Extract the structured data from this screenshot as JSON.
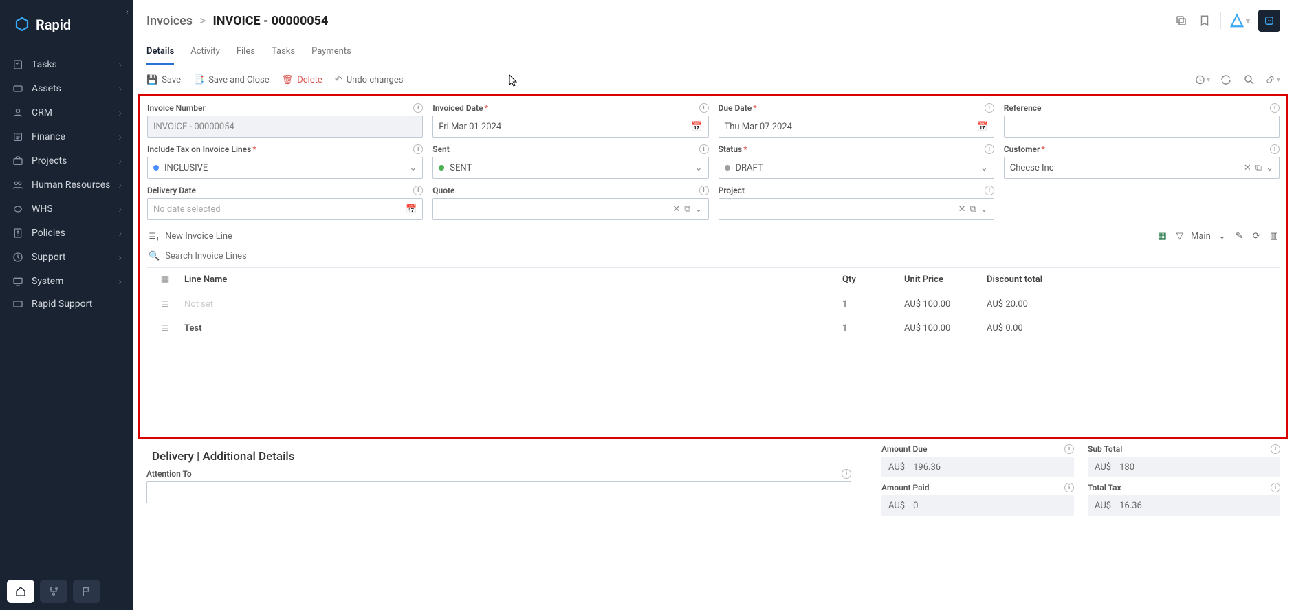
{
  "brand": {
    "name": "Rapid"
  },
  "sidebar": {
    "items": [
      {
        "label": "Tasks"
      },
      {
        "label": "Assets"
      },
      {
        "label": "CRM"
      },
      {
        "label": "Finance"
      },
      {
        "label": "Projects"
      },
      {
        "label": "Human Resources"
      },
      {
        "label": "WHS"
      },
      {
        "label": "Policies"
      },
      {
        "label": "Support"
      },
      {
        "label": "System"
      },
      {
        "label": "Rapid Support"
      }
    ]
  },
  "breadcrumb": {
    "parent": "Invoices",
    "sep": ">",
    "current": "INVOICE - 00000054"
  },
  "tabs": [
    {
      "label": "Details",
      "active": true
    },
    {
      "label": "Activity"
    },
    {
      "label": "Files"
    },
    {
      "label": "Tasks"
    },
    {
      "label": "Payments"
    }
  ],
  "toolbar": {
    "save": "Save",
    "save_close": "Save and Close",
    "delete": "Delete",
    "undo": "Undo changes"
  },
  "form": {
    "invoice_number": {
      "label": "Invoice Number",
      "value": "INVOICE - 00000054"
    },
    "invoiced_date": {
      "label": "Invoiced Date",
      "value": "Fri Mar 01 2024",
      "required": true
    },
    "due_date": {
      "label": "Due Date",
      "value": "Thu Mar 07 2024",
      "required": true
    },
    "reference": {
      "label": "Reference",
      "value": ""
    },
    "include_tax": {
      "label": "Include Tax on Invoice Lines",
      "value": "INCLUSIVE",
      "required": true
    },
    "sent": {
      "label": "Sent",
      "value": "SENT"
    },
    "status": {
      "label": "Status",
      "value": "DRAFT",
      "required": true
    },
    "customer": {
      "label": "Customer",
      "value": "Cheese Inc",
      "required": true
    },
    "delivery_date": {
      "label": "Delivery Date",
      "value": "No date selected"
    },
    "quote": {
      "label": "Quote",
      "value": ""
    },
    "project": {
      "label": "Project",
      "value": ""
    }
  },
  "lines_bar": {
    "new": "New Invoice Line",
    "filter_view": "Main"
  },
  "search": {
    "placeholder": "Search Invoice Lines"
  },
  "table": {
    "headers": {
      "name": "Line Name",
      "qty": "Qty",
      "unit": "Unit Price",
      "disc": "Discount total"
    },
    "rows": [
      {
        "name": "Not set",
        "notset": true,
        "qty": "1",
        "unit": "AU$ 100.00",
        "disc": "AU$ 20.00"
      },
      {
        "name": "Test",
        "bold": true,
        "qty": "1",
        "unit": "AU$ 100.00",
        "disc": "AU$ 0.00"
      }
    ]
  },
  "delivery_section": {
    "title": "Delivery | Additional Details",
    "attention_to": "Attention To"
  },
  "summary": {
    "amount_due": {
      "label": "Amount Due",
      "currency": "AU$",
      "value": "196.36"
    },
    "sub_total": {
      "label": "Sub Total",
      "currency": "AU$",
      "value": "180"
    },
    "amount_paid": {
      "label": "Amount Paid",
      "currency": "AU$",
      "value": "0"
    },
    "total_tax": {
      "label": "Total Tax",
      "currency": "AU$",
      "value": "16.36"
    }
  }
}
